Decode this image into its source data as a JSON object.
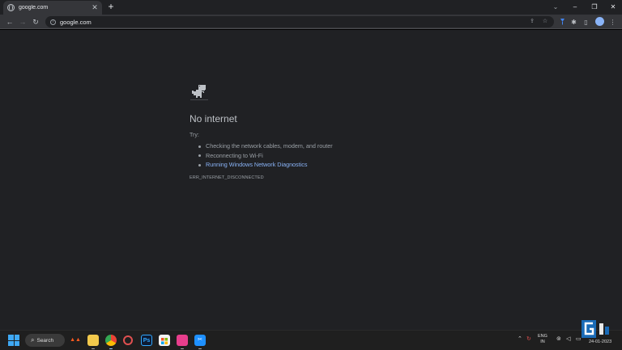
{
  "browser": {
    "tab_title": "google.com",
    "new_tab_label": "+",
    "url": "google.com"
  },
  "error_page": {
    "title": "No internet",
    "try_label": "Try:",
    "suggestions": [
      "Checking the network cables, modem, and router",
      "Reconnecting to Wi-Fi",
      "Running Windows Network Diagnostics"
    ],
    "error_code": "ERR_INTERNET_DISCONNECTED"
  },
  "taskbar": {
    "search_label": "Search",
    "language_line1": "ENG",
    "language_line2": "IN",
    "date": "24-01-2023"
  },
  "colors": {
    "page_bg": "#202124",
    "link": "#8ab4f8",
    "taskbar_bg": "#1f1f1f",
    "windows_blue": "#3fa9f5"
  },
  "icons": {
    "tab_favicon": "globe-icon",
    "back": "arrow-left-icon",
    "forward": "arrow-right-icon",
    "reload": "reload-icon",
    "site_info": "info-icon",
    "share": "share-icon",
    "bookmark": "star-icon",
    "extension": "puzzle-icon",
    "side_panel": "side-panel-icon",
    "menu": "kebab-menu-icon"
  }
}
